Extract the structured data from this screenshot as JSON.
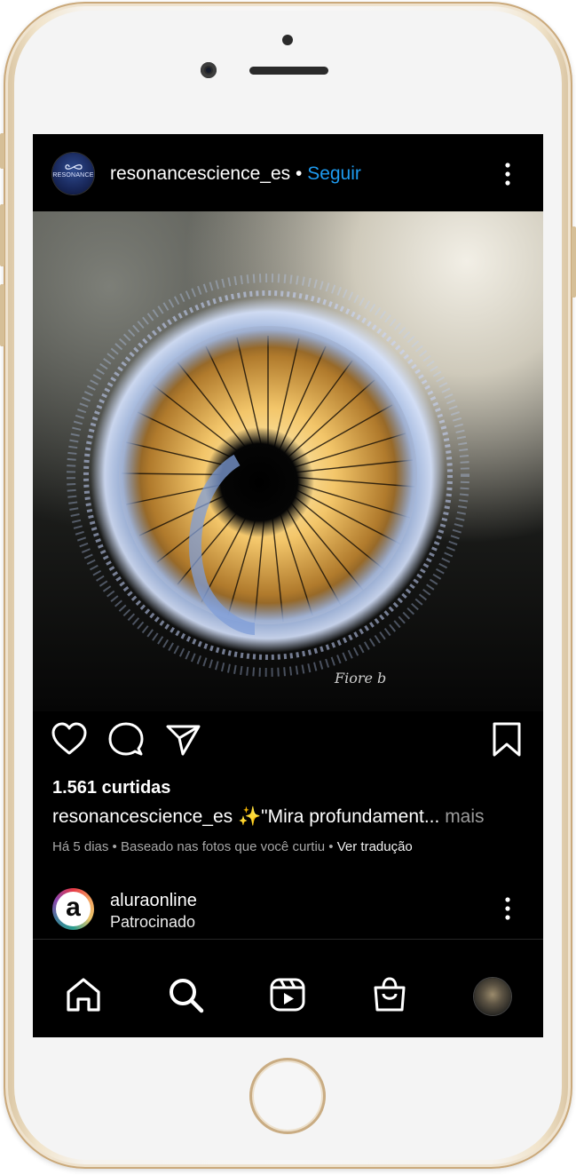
{
  "post": {
    "account": {
      "username": "resonancescience_es",
      "separator": "•",
      "follow_label": "Seguir",
      "avatar_text": "RESONANCE"
    },
    "photo": {
      "watermark": "Fiore b"
    },
    "likes_text": "1.561 curtidas",
    "caption": {
      "username": "resonancescience_es",
      "text": " ✨\"Mira profundament",
      "ellipsis": "...",
      "more_label": " mais"
    },
    "meta": {
      "time": "Há 5 dias",
      "separator1": " • ",
      "reason": "Baseado nas fotos que você curtiu",
      "separator2": " • ",
      "translate_label": "Ver tradução"
    }
  },
  "sponsored": {
    "username": "aluraonline",
    "label": "Patrocinado",
    "avatar_letter": "a"
  },
  "icons": {
    "more": "more-vertical-icon",
    "like": "heart-icon",
    "comment": "comment-bubble-icon",
    "share": "paper-plane-icon",
    "save": "bookmark-icon",
    "nav": [
      "home-icon",
      "search-icon",
      "reels-icon",
      "shop-bag-icon",
      "profile-avatar"
    ]
  },
  "colors": {
    "link_blue": "#1e9bf0",
    "screen_bg": "#000000",
    "muted_text": "#a7a7a7",
    "phone_gold": "#d8c3a0"
  }
}
